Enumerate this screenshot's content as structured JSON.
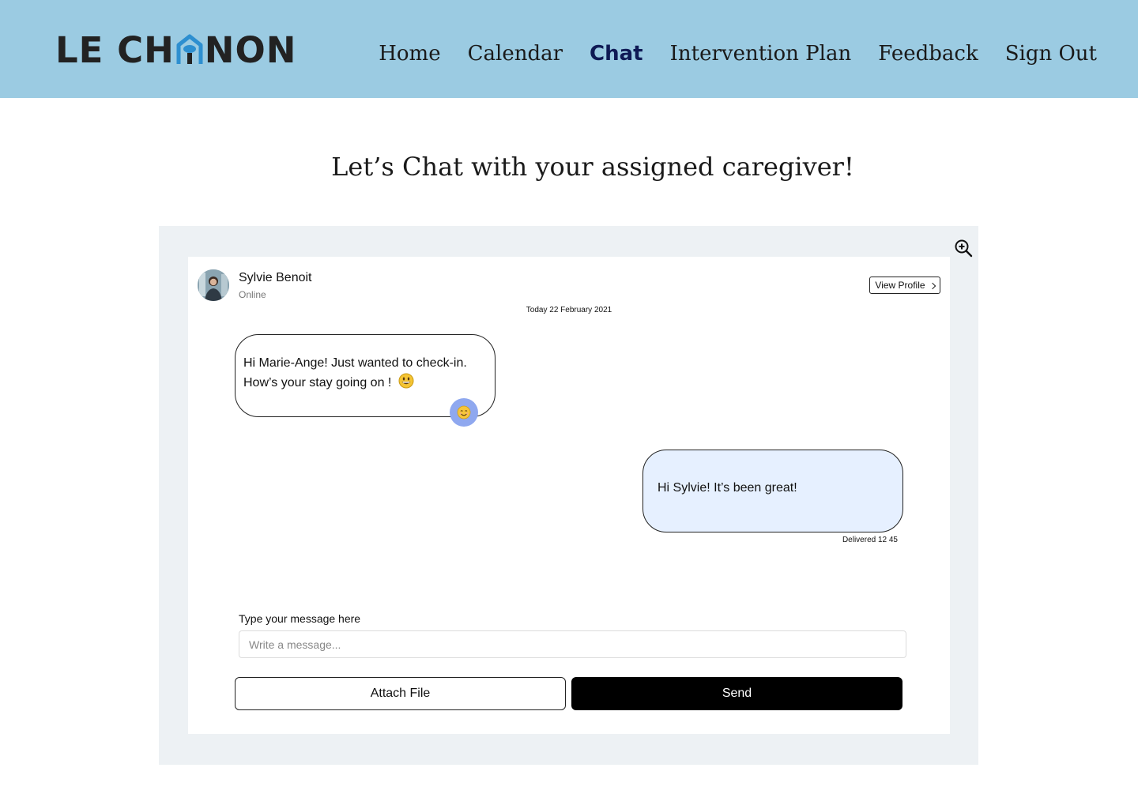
{
  "header": {
    "logo_left": "LE CH",
    "logo_right": "NON",
    "nav": [
      {
        "label": "Home",
        "active": false
      },
      {
        "label": "Calendar",
        "active": false
      },
      {
        "label": "Chat",
        "active": true
      },
      {
        "label": "Intervention Plan",
        "active": false
      },
      {
        "label": "Feedback",
        "active": false
      },
      {
        "label": "Sign Out",
        "active": false
      }
    ],
    "background_color": "#9bcbe2"
  },
  "page_title": "Let’s Chat with your assigned caregiver!",
  "chat": {
    "contact": {
      "name": "Sylvie Benoit",
      "status": "Online",
      "view_profile_label": "View Profile"
    },
    "date_label": "Today 22 February 2021",
    "messages": [
      {
        "direction": "incoming",
        "line1": "Hi Marie-Ange! Just wanted to check-in.",
        "line2": "How’s your stay going on !",
        "inline_icon": "grinning-face-emoji-icon",
        "reaction_icon": "smiling-face-emoji-icon"
      },
      {
        "direction": "outgoing",
        "text": "Hi Sylvie! It’s been great!",
        "status": "Delivered 12 45",
        "bubble_color": "#e6f0ff"
      }
    ],
    "composer": {
      "label": "Type your message here",
      "placeholder": "Write a message...",
      "value": "",
      "attach_label": "Attach File",
      "send_label": "Send"
    },
    "zoom_icon": "zoom-in-icon"
  }
}
